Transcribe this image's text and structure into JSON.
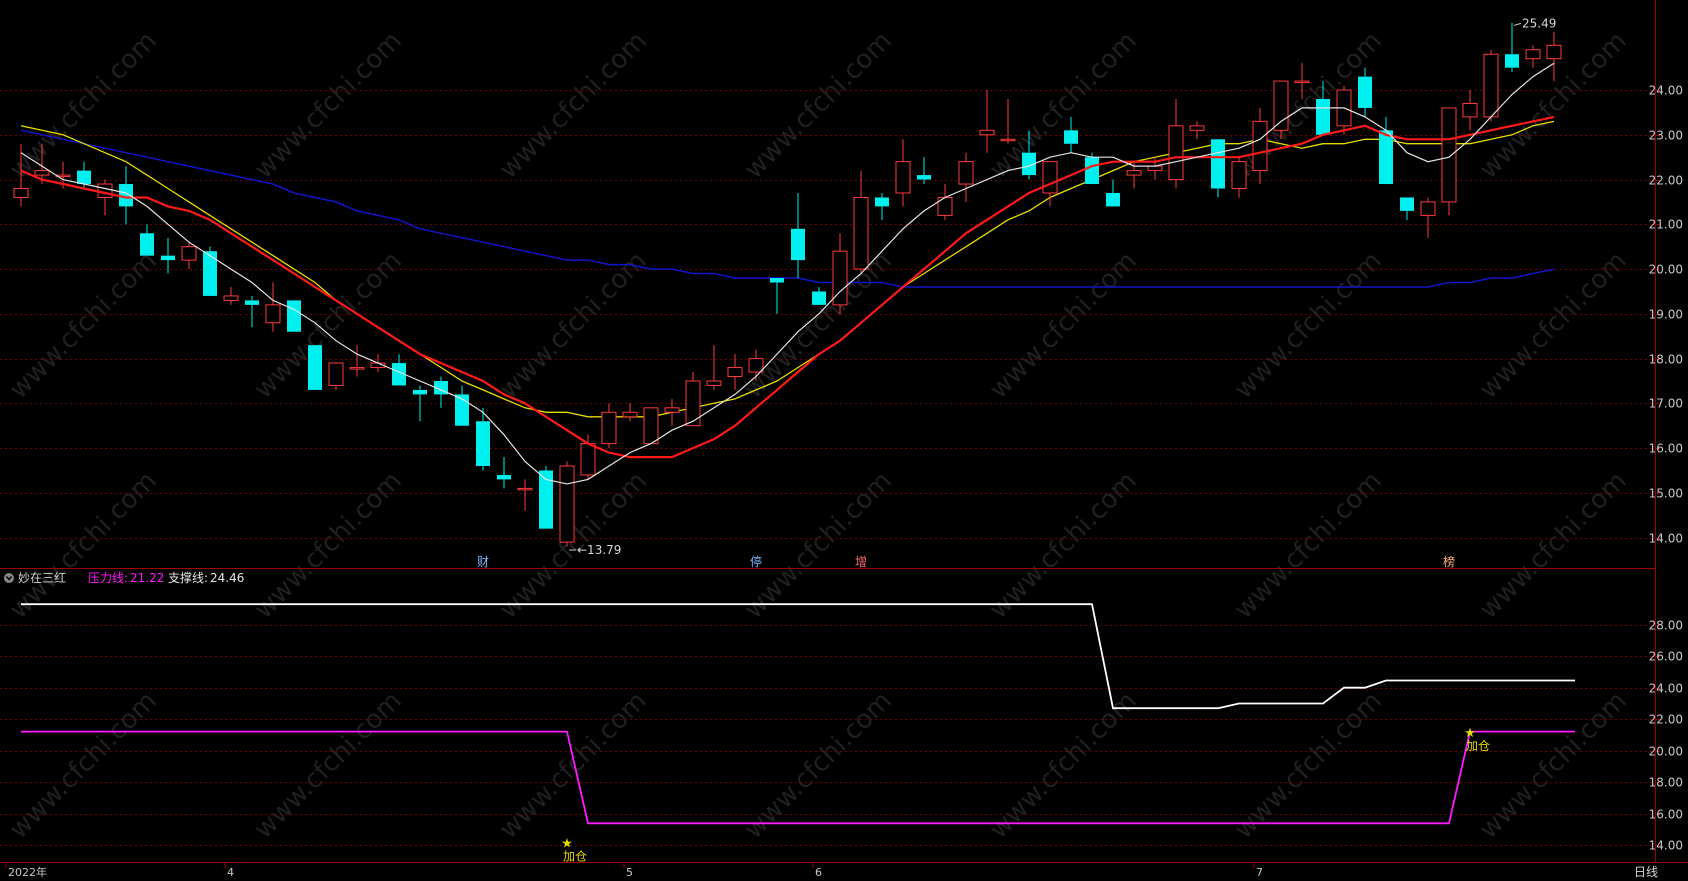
{
  "colors": {
    "background": "#000000",
    "grid": "#6e0000",
    "axis": "#a00000",
    "up_candle": "#ff3b3b",
    "down_candle": "#00f0f0",
    "ma_white": "#e6e6e6",
    "ma_red": "#ff1a1a",
    "ma_yellow": "#e6dd00",
    "ma_blue": "#1414c8",
    "pressure_line": "#ff1aff",
    "support_line": "#ffffff",
    "label_text": "#c0c0c0",
    "signal_text": "#e6dd00"
  },
  "chart_data": [
    {
      "type": "candlestick",
      "panel": "main",
      "ylim": [
        13.5,
        25.9
      ],
      "yticks": [
        "14.00",
        "15.00",
        "16.00",
        "17.00",
        "18.00",
        "19.00",
        "20.00",
        "21.00",
        "22.00",
        "23.00",
        "24.00"
      ],
      "ytick_values": [
        14,
        15,
        16,
        17,
        18,
        19,
        20,
        21,
        22,
        23,
        24
      ],
      "grid": true,
      "candles": [
        {
          "o": 21.6,
          "h": 22.8,
          "l": 21.4,
          "c": 21.8
        },
        {
          "o": 22.1,
          "h": 22.8,
          "l": 21.9,
          "c": 22.2
        },
        {
          "o": 22.1,
          "h": 22.4,
          "l": 21.8,
          "c": 22.1
        },
        {
          "o": 22.2,
          "h": 22.4,
          "l": 21.8,
          "c": 21.9
        },
        {
          "o": 21.6,
          "h": 22.0,
          "l": 21.2,
          "c": 21.9
        },
        {
          "o": 21.9,
          "h": 22.3,
          "l": 21.0,
          "c": 21.4
        },
        {
          "o": 20.8,
          "h": 21.0,
          "l": 20.3,
          "c": 20.3
        },
        {
          "o": 20.3,
          "h": 20.7,
          "l": 19.9,
          "c": 20.2
        },
        {
          "o": 20.2,
          "h": 20.6,
          "l": 20.0,
          "c": 20.5
        },
        {
          "o": 20.4,
          "h": 20.5,
          "l": 19.4,
          "c": 19.4
        },
        {
          "o": 19.3,
          "h": 19.6,
          "l": 19.2,
          "c": 19.4
        },
        {
          "o": 19.3,
          "h": 19.4,
          "l": 18.7,
          "c": 19.2
        },
        {
          "o": 18.8,
          "h": 19.7,
          "l": 18.6,
          "c": 19.2
        },
        {
          "o": 19.3,
          "h": 19.3,
          "l": 18.6,
          "c": 18.6
        },
        {
          "o": 18.3,
          "h": 18.3,
          "l": 17.3,
          "c": 17.3
        },
        {
          "o": 17.4,
          "h": 17.9,
          "l": 17.3,
          "c": 17.9
        },
        {
          "o": 17.8,
          "h": 18.3,
          "l": 17.6,
          "c": 17.8
        },
        {
          "o": 17.8,
          "h": 18.1,
          "l": 17.7,
          "c": 17.9
        },
        {
          "o": 17.9,
          "h": 18.1,
          "l": 17.4,
          "c": 17.4
        },
        {
          "o": 17.3,
          "h": 17.4,
          "l": 16.6,
          "c": 17.2
        },
        {
          "o": 17.5,
          "h": 17.6,
          "l": 16.9,
          "c": 17.2
        },
        {
          "o": 17.2,
          "h": 17.4,
          "l": 16.5,
          "c": 16.5
        },
        {
          "o": 16.6,
          "h": 16.9,
          "l": 15.5,
          "c": 15.6
        },
        {
          "o": 15.4,
          "h": 15.8,
          "l": 15.1,
          "c": 15.3
        },
        {
          "o": 15.1,
          "h": 15.3,
          "l": 14.6,
          "c": 15.1
        },
        {
          "o": 15.5,
          "h": 15.6,
          "l": 14.2,
          "c": 14.2
        },
        {
          "o": 13.9,
          "h": 15.7,
          "l": 13.8,
          "c": 15.6
        },
        {
          "o": 15.4,
          "h": 16.3,
          "l": 15.3,
          "c": 16.1
        },
        {
          "o": 16.1,
          "h": 17.0,
          "l": 16.0,
          "c": 16.8
        },
        {
          "o": 16.7,
          "h": 17.0,
          "l": 16.6,
          "c": 16.8
        },
        {
          "o": 16.1,
          "h": 16.9,
          "l": 16.1,
          "c": 16.9
        },
        {
          "o": 16.8,
          "h": 17.1,
          "l": 16.5,
          "c": 16.9
        },
        {
          "o": 16.5,
          "h": 17.7,
          "l": 16.5,
          "c": 17.5
        },
        {
          "o": 17.4,
          "h": 18.3,
          "l": 17.3,
          "c": 17.5
        },
        {
          "o": 17.6,
          "h": 18.1,
          "l": 17.3,
          "c": 17.8
        },
        {
          "o": 17.7,
          "h": 18.2,
          "l": 17.5,
          "c": 18.0
        },
        {
          "o": 19.8,
          "h": 19.8,
          "l": 19.0,
          "c": 19.7
        },
        {
          "o": 20.9,
          "h": 21.7,
          "l": 19.8,
          "c": 20.2
        },
        {
          "o": 19.5,
          "h": 19.6,
          "l": 19.2,
          "c": 19.2
        },
        {
          "o": 19.2,
          "h": 20.8,
          "l": 19.0,
          "c": 20.4
        },
        {
          "o": 20.0,
          "h": 22.2,
          "l": 19.9,
          "c": 21.6
        },
        {
          "o": 21.6,
          "h": 21.7,
          "l": 21.1,
          "c": 21.4
        },
        {
          "o": 21.7,
          "h": 22.9,
          "l": 21.4,
          "c": 22.4
        },
        {
          "o": 22.1,
          "h": 22.5,
          "l": 21.9,
          "c": 22.0
        },
        {
          "o": 21.2,
          "h": 21.9,
          "l": 21.1,
          "c": 21.6
        },
        {
          "o": 21.9,
          "h": 22.6,
          "l": 21.5,
          "c": 22.4
        },
        {
          "o": 23.0,
          "h": 24.0,
          "l": 22.6,
          "c": 23.1
        },
        {
          "o": 22.9,
          "h": 23.8,
          "l": 22.8,
          "c": 22.9
        },
        {
          "o": 22.6,
          "h": 23.1,
          "l": 22.0,
          "c": 22.1
        },
        {
          "o": 21.7,
          "h": 22.2,
          "l": 21.4,
          "c": 22.4
        },
        {
          "o": 23.1,
          "h": 23.4,
          "l": 22.6,
          "c": 22.8
        },
        {
          "o": 22.5,
          "h": 22.6,
          "l": 21.9,
          "c": 21.9
        },
        {
          "o": 21.7,
          "h": 22.0,
          "l": 21.5,
          "c": 21.4
        },
        {
          "o": 22.1,
          "h": 22.4,
          "l": 21.8,
          "c": 22.2
        },
        {
          "o": 22.2,
          "h": 22.5,
          "l": 22.0,
          "c": 22.3
        },
        {
          "o": 22.0,
          "h": 23.8,
          "l": 21.8,
          "c": 23.2
        },
        {
          "o": 23.1,
          "h": 23.3,
          "l": 22.9,
          "c": 23.2
        },
        {
          "o": 22.9,
          "h": 22.9,
          "l": 21.6,
          "c": 21.8
        },
        {
          "o": 21.8,
          "h": 22.5,
          "l": 21.6,
          "c": 22.4
        },
        {
          "o": 22.2,
          "h": 23.6,
          "l": 21.9,
          "c": 23.3
        },
        {
          "o": 23.1,
          "h": 24.2,
          "l": 22.9,
          "c": 24.2
        },
        {
          "o": 24.2,
          "h": 24.6,
          "l": 23.8,
          "c": 24.2
        },
        {
          "o": 23.8,
          "h": 24.2,
          "l": 23.3,
          "c": 23.0
        },
        {
          "o": 23.2,
          "h": 24.1,
          "l": 23.0,
          "c": 24.0
        },
        {
          "o": 24.3,
          "h": 24.5,
          "l": 23.4,
          "c": 23.6
        },
        {
          "o": 23.1,
          "h": 23.4,
          "l": 21.9,
          "c": 21.9
        },
        {
          "o": 21.6,
          "h": 21.6,
          "l": 21.1,
          "c": 21.3
        },
        {
          "o": 21.2,
          "h": 21.6,
          "l": 20.7,
          "c": 21.5
        },
        {
          "o": 21.5,
          "h": 23.6,
          "l": 21.2,
          "c": 23.6
        },
        {
          "o": 23.4,
          "h": 24.0,
          "l": 23.1,
          "c": 23.7
        },
        {
          "o": 23.4,
          "h": 24.9,
          "l": 23.3,
          "c": 24.8
        },
        {
          "o": 24.8,
          "h": 25.5,
          "l": 24.4,
          "c": 24.5
        },
        {
          "o": 24.7,
          "h": 25.0,
          "l": 24.5,
          "c": 24.9
        },
        {
          "o": 24.7,
          "h": 25.3,
          "l": 24.2,
          "c": 25.0
        }
      ],
      "ma_white": [
        22.6,
        22.3,
        22.0,
        21.9,
        21.8,
        21.7,
        21.4,
        21.0,
        20.6,
        20.3,
        20.0,
        19.7,
        19.3,
        19.1,
        18.8,
        18.4,
        18.1,
        17.9,
        17.7,
        17.5,
        17.3,
        17.1,
        16.8,
        16.3,
        15.7,
        15.3,
        15.2,
        15.3,
        15.6,
        15.9,
        16.1,
        16.4,
        16.6,
        16.9,
        17.2,
        17.6,
        18.1,
        18.6,
        19.0,
        19.5,
        19.9,
        20.4,
        20.9,
        21.3,
        21.6,
        21.8,
        22.0,
        22.2,
        22.3,
        22.5,
        22.6,
        22.5,
        22.5,
        22.3,
        22.3,
        22.4,
        22.5,
        22.6,
        22.7,
        22.9,
        23.3,
        23.6,
        23.6,
        23.6,
        23.4,
        23.1,
        22.6,
        22.4,
        22.5,
        22.9,
        23.4,
        23.9,
        24.3,
        24.6
      ],
      "ma_red": [
        22.2,
        22.0,
        21.9,
        21.8,
        21.7,
        21.6,
        21.6,
        21.4,
        21.3,
        21.1,
        20.8,
        20.5,
        20.2,
        19.9,
        19.6,
        19.3,
        19.0,
        18.7,
        18.4,
        18.1,
        17.9,
        17.7,
        17.5,
        17.2,
        17.0,
        16.7,
        16.4,
        16.1,
        15.9,
        15.8,
        15.8,
        15.8,
        16.0,
        16.2,
        16.5,
        16.9,
        17.3,
        17.7,
        18.1,
        18.4,
        18.8,
        19.2,
        19.6,
        20.0,
        20.4,
        20.8,
        21.1,
        21.4,
        21.7,
        21.9,
        22.1,
        22.3,
        22.4,
        22.4,
        22.4,
        22.5,
        22.5,
        22.5,
        22.5,
        22.6,
        22.7,
        22.8,
        23.0,
        23.1,
        23.2,
        23.0,
        22.9,
        22.9,
        22.9,
        23.0,
        23.1,
        23.2,
        23.3,
        23.4
      ],
      "ma_yellow": [
        23.2,
        23.1,
        23.0,
        22.8,
        22.6,
        22.4,
        22.1,
        21.8,
        21.5,
        21.2,
        20.9,
        20.6,
        20.3,
        20.0,
        19.7,
        19.3,
        19.0,
        18.7,
        18.4,
        18.1,
        17.8,
        17.5,
        17.3,
        17.1,
        16.9,
        16.8,
        16.8,
        16.7,
        16.7,
        16.7,
        16.7,
        16.8,
        16.9,
        17.0,
        17.1,
        17.3,
        17.5,
        17.8,
        18.1,
        18.4,
        18.8,
        19.2,
        19.6,
        19.9,
        20.2,
        20.5,
        20.8,
        21.1,
        21.3,
        21.6,
        21.8,
        22.0,
        22.2,
        22.4,
        22.5,
        22.6,
        22.7,
        22.8,
        22.8,
        22.9,
        22.8,
        22.7,
        22.8,
        22.8,
        22.9,
        22.9,
        22.8,
        22.8,
        22.8,
        22.8,
        22.9,
        23.0,
        23.2,
        23.3
      ],
      "ma_blue": [
        23.1,
        23.0,
        22.9,
        22.8,
        22.7,
        22.6,
        22.5,
        22.4,
        22.3,
        22.2,
        22.1,
        22.0,
        21.9,
        21.7,
        21.6,
        21.5,
        21.3,
        21.2,
        21.1,
        20.9,
        20.8,
        20.7,
        20.6,
        20.5,
        20.4,
        20.3,
        20.2,
        20.2,
        20.1,
        20.1,
        20.0,
        20.0,
        19.9,
        19.9,
        19.8,
        19.8,
        19.8,
        19.8,
        19.7,
        19.7,
        19.7,
        19.7,
        19.6,
        19.6,
        19.6,
        19.6,
        19.6,
        19.6,
        19.6,
        19.6,
        19.6,
        19.6,
        19.6,
        19.6,
        19.6,
        19.6,
        19.6,
        19.6,
        19.6,
        19.6,
        19.6,
        19.6,
        19.6,
        19.6,
        19.6,
        19.6,
        19.6,
        19.6,
        19.7,
        19.7,
        19.8,
        19.8,
        19.9,
        20.0
      ],
      "annotations": [
        {
          "text": "25.49",
          "index": 71,
          "value": 25.49
        },
        {
          "text": "13.79",
          "index": 26,
          "value": 13.79
        }
      ],
      "event_markers": [
        {
          "text": "财",
          "index": 22
        },
        {
          "text": "停",
          "index": 35
        },
        {
          "text": "增",
          "index": 40
        },
        {
          "text": "榜",
          "index": 68
        }
      ]
    },
    {
      "type": "line",
      "panel": "indicator",
      "title": "妙在三红",
      "legend": [
        {
          "name": "压力线",
          "value": "21.22",
          "color": "#ff1aff"
        },
        {
          "name": "支撑线",
          "value": "24.46",
          "color": "#ffffff"
        }
      ],
      "ylim": [
        13.2,
        30.2
      ],
      "yticks": [
        "14.00",
        "16.00",
        "18.00",
        "20.00",
        "22.00",
        "24.00",
        "26.00",
        "28.00"
      ],
      "ytick_values": [
        14,
        16,
        18,
        20,
        22,
        24,
        26,
        28
      ],
      "grid": true,
      "series": [
        {
          "name": "支撑线",
          "points": [
            [
              0,
              29.3
            ],
            [
              51,
              29.3
            ],
            [
              52,
              22.7
            ],
            [
              57,
              22.7
            ],
            [
              58,
              23.0
            ],
            [
              62,
              23.0
            ],
            [
              63,
              24.0
            ],
            [
              64,
              24.0
            ],
            [
              65,
              24.46
            ],
            [
              74,
              24.46
            ]
          ]
        },
        {
          "name": "压力线",
          "points": [
            [
              0,
              21.22
            ],
            [
              26,
              21.22
            ],
            [
              27,
              15.4
            ],
            [
              68,
              15.4
            ],
            [
              69,
              21.22
            ],
            [
              74,
              21.22
            ]
          ]
        }
      ],
      "signals": [
        {
          "text": "加仓",
          "index": 26,
          "value": 14.0
        },
        {
          "text": "加仓",
          "index": 69,
          "value": 21.0
        }
      ]
    }
  ],
  "x_axis": {
    "labels": [
      {
        "text": "2022年",
        "index": 0
      },
      {
        "text": "4",
        "index": 10
      },
      {
        "text": "5",
        "index": 29
      },
      {
        "text": "6",
        "index": 38
      },
      {
        "text": "7",
        "index": 59
      }
    ],
    "period_label": "日线"
  },
  "indicator_header": {
    "title": "妙在三红",
    "pressure_label": "压力线:",
    "pressure_value": "21.22",
    "support_label": "支撑线:",
    "support_value": "24.46"
  },
  "watermark": "www.cfchi.com"
}
